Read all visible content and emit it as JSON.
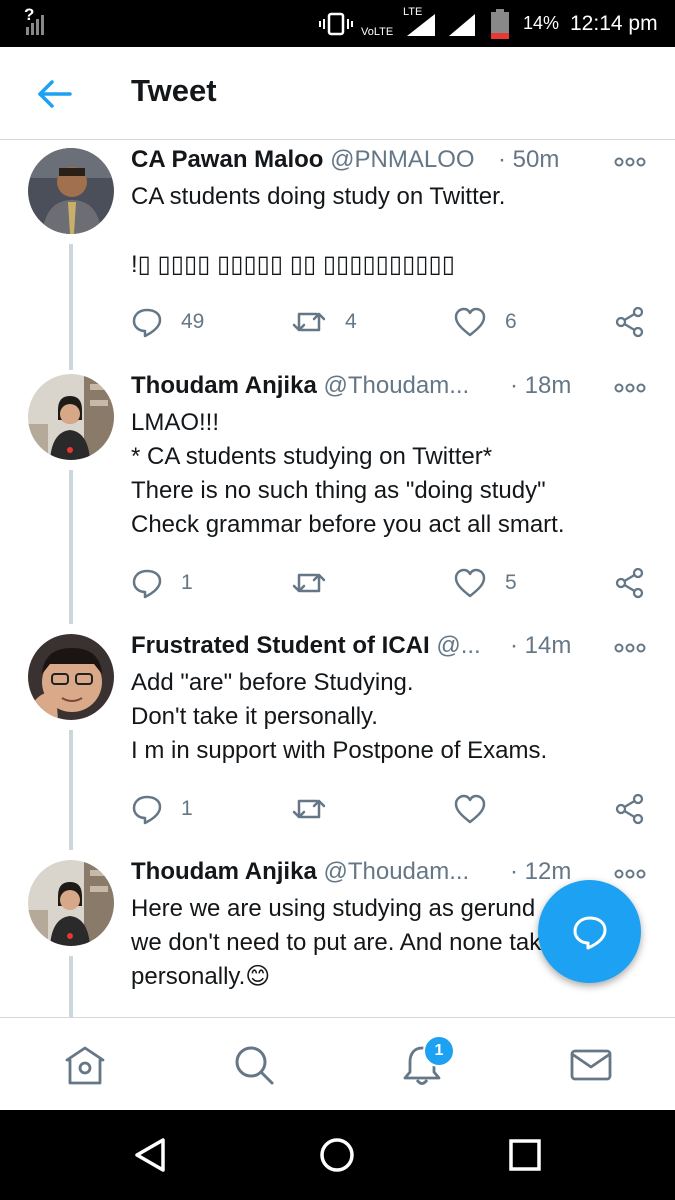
{
  "status_bar": {
    "signal_mark": "?",
    "volte": "VoLTE",
    "lte": "LTE",
    "battery": "14%",
    "time": "12:14 pm",
    "battery_color": "#e53935"
  },
  "header": {
    "title": "Tweet",
    "accent": "#1da1f2"
  },
  "tweets": [
    {
      "name": "CA Pawan Maloo",
      "handle": "@PNMALOO",
      "time": "· 50m",
      "text": "CA students doing study on Twitter.\n\n!▯  ▯▯▯▯ ▯▯▯▯▯ ▯▯ ▯▯▯▯▯▯▯▯▯▯",
      "replies": "49",
      "retweets": "4",
      "likes": "6"
    },
    {
      "name": "Thoudam Anjika",
      "handle": "@Thoudam...",
      "time": "· 18m",
      "text": "LMAO!!!\n* CA students studying on Twitter*\nThere is no such thing as \"doing study\"\nCheck grammar before you act all smart.",
      "replies": "1",
      "retweets": "",
      "likes": "5"
    },
    {
      "name": "Frustrated Student of ICAI",
      "handle": "@...",
      "time": "· 14m",
      "text": "Add \"are\" before Studying.\nDon't take it personally.\nI m in support with Postpone of Exams.",
      "replies": "1",
      "retweets": "",
      "likes": ""
    },
    {
      "name": "Thoudam Anjika",
      "handle": "@Thoudam...",
      "time": "· 12m",
      "text": "Here we are using studying as gerund\nwe don't need to put are. And none take\npersonally.😊",
      "replies": "",
      "retweets": "",
      "likes": ""
    }
  ],
  "bottom_nav": {
    "notifications_badge": "1"
  },
  "icons": {
    "back": "arrow-left-icon",
    "more": "more-dots-icon",
    "reply": "reply-icon",
    "retweet": "retweet-icon",
    "like": "heart-icon",
    "share": "share-icon",
    "compose": "compose-message-icon",
    "home": "home-icon",
    "search": "search-icon",
    "notifications": "bell-icon",
    "messages": "mail-icon"
  }
}
